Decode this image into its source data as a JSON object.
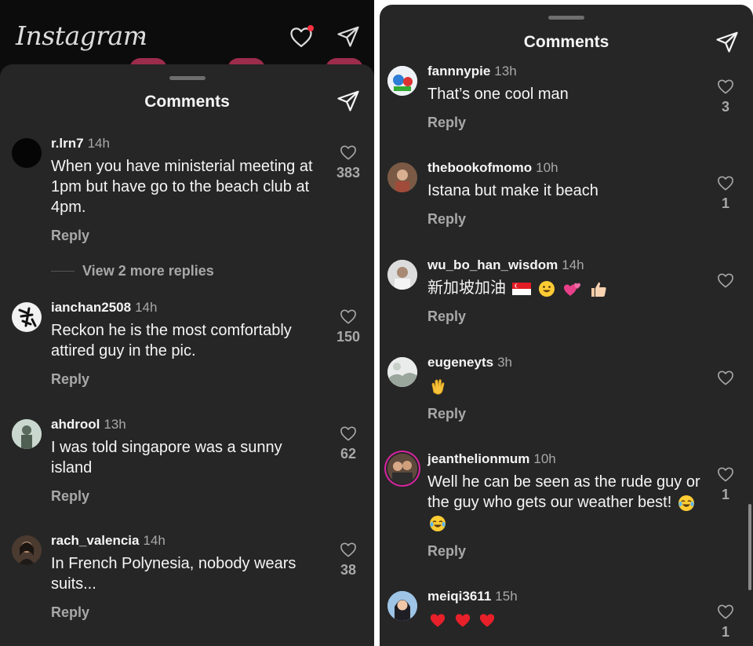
{
  "left": {
    "header": {
      "app_name": "Instagram"
    },
    "sheet_title": "Comments",
    "comments": [
      {
        "username": "r.lrn7",
        "time": "14h",
        "text": "When you have ministerial meeting at 1pm but have go to the beach club at 4pm.",
        "reply": "Reply",
        "likes": "383"
      },
      {
        "username": "ianchan2508",
        "time": "14h",
        "text": "Reckon he is the most comfortably attired guy in the pic.",
        "reply": "Reply",
        "likes": "150"
      },
      {
        "username": "ahdrool",
        "time": "13h",
        "text": "I was told singapore was a sunny island",
        "reply": "Reply",
        "likes": "62"
      },
      {
        "username": "rach_valencia",
        "time": "14h",
        "text": "In French Polynesia, nobody wears suits...",
        "reply": "Reply",
        "likes": "38"
      }
    ],
    "view_more": "View 2 more replies"
  },
  "right": {
    "sheet_title": "Comments",
    "comments": [
      {
        "username": "fannnypie",
        "time": "13h",
        "text": "That’s one cool man",
        "reply": "Reply",
        "likes": "3"
      },
      {
        "username": "thebookofmomo",
        "time": "10h",
        "text": "Istana but make it beach",
        "reply": "Reply",
        "likes": "1"
      },
      {
        "username": "wu_bo_han_wisdom",
        "time": "14h",
        "text": "新加坡加油",
        "reply": "Reply",
        "likes": ""
      },
      {
        "username": "eugeneyts",
        "time": "3h",
        "text": "",
        "reply": "Reply",
        "likes": ""
      },
      {
        "username": "jeanthelionmum",
        "time": "10h",
        "text": "Well he can be seen as the rude guy or the guy who gets our weather best!",
        "reply": "Reply",
        "likes": "1"
      },
      {
        "username": "meiqi3611",
        "time": "15h",
        "text": "",
        "reply": "",
        "likes": "1"
      }
    ]
  },
  "colors": {
    "background": "#262626",
    "text": "#f5f5f5",
    "muted": "#a8a8a8",
    "notification": "#ff3040"
  }
}
